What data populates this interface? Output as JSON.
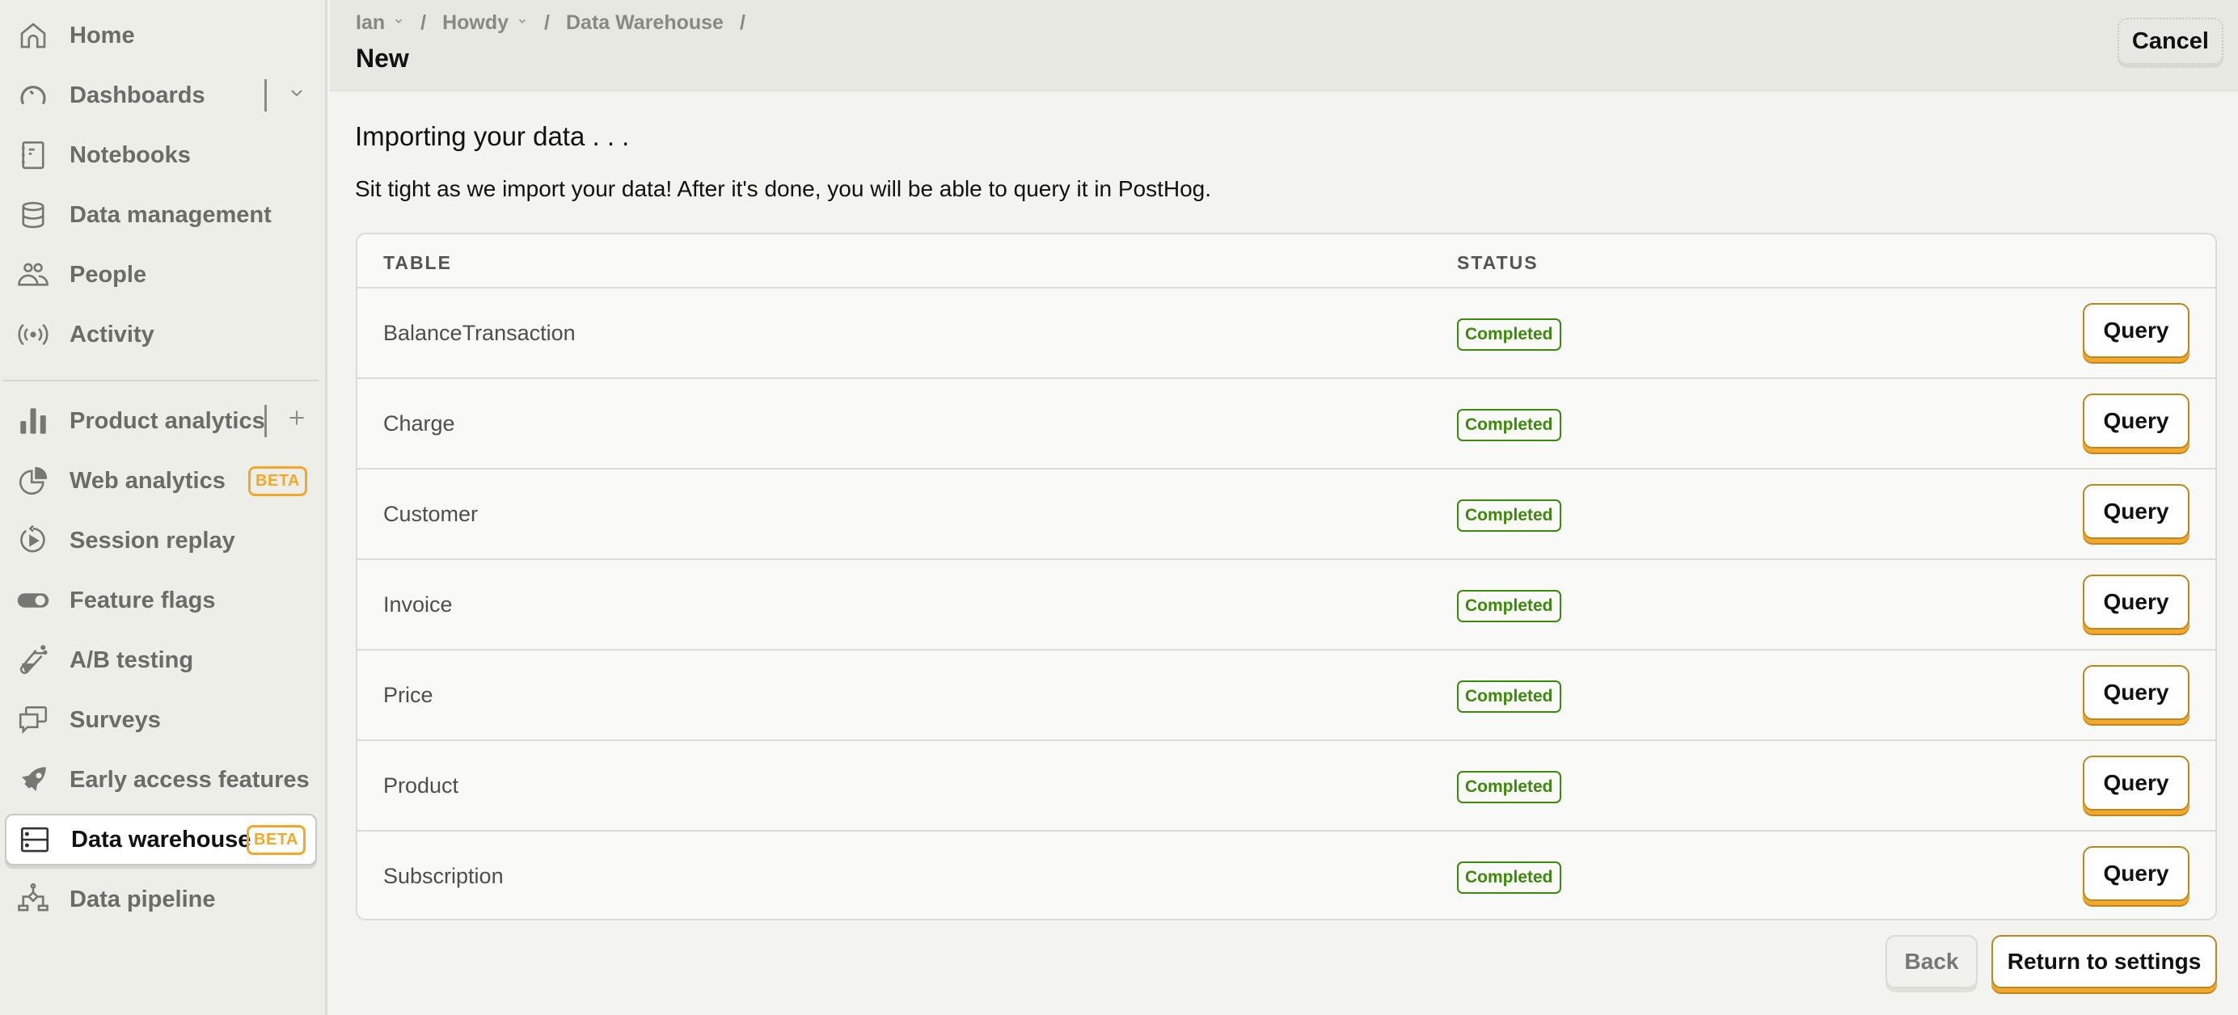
{
  "sidebar": {
    "items": [
      {
        "label": "Home",
        "icon": "home-icon"
      },
      {
        "label": "Dashboards",
        "icon": "dashboard-gauge-icon",
        "extra": "chevron-down"
      },
      {
        "label": "Notebooks",
        "icon": "notebook-icon"
      },
      {
        "label": "Data management",
        "icon": "database-icon"
      },
      {
        "label": "People",
        "icon": "people-icon"
      },
      {
        "label": "Activity",
        "icon": "activity-broadcast-icon"
      },
      {
        "label": "Product analytics",
        "icon": "bar-chart-icon",
        "extra": "plus"
      },
      {
        "label": "Web analytics",
        "icon": "pie-chart-icon",
        "badge": "BETA"
      },
      {
        "label": "Session replay",
        "icon": "replay-icon"
      },
      {
        "label": "Feature flags",
        "icon": "toggle-icon"
      },
      {
        "label": "A/B testing",
        "icon": "test-tube-icon"
      },
      {
        "label": "Surveys",
        "icon": "chat-bubbles-icon"
      },
      {
        "label": "Early access features",
        "icon": "rocket-icon"
      },
      {
        "label": "Data warehouse",
        "icon": "server-icon",
        "badge": "BETA",
        "active": true
      },
      {
        "label": "Data pipeline",
        "icon": "pipeline-icon"
      }
    ]
  },
  "header": {
    "breadcrumb": [
      {
        "label": "Ian",
        "dropdown": true
      },
      {
        "label": "Howdy",
        "dropdown": true
      },
      {
        "label": "Data Warehouse",
        "dropdown": false
      }
    ],
    "title": "New",
    "cancel_label": "Cancel"
  },
  "main": {
    "heading": "Importing your data . . .",
    "description": "Sit tight as we import your data! After it's done, you will be able to query it in PostHog.",
    "table": {
      "columns": [
        "TABLE",
        "STATUS"
      ],
      "rows": [
        {
          "name": "BalanceTransaction",
          "status": "Completed",
          "action": "Query"
        },
        {
          "name": "Charge",
          "status": "Completed",
          "action": "Query"
        },
        {
          "name": "Customer",
          "status": "Completed",
          "action": "Query"
        },
        {
          "name": "Invoice",
          "status": "Completed",
          "action": "Query"
        },
        {
          "name": "Price",
          "status": "Completed",
          "action": "Query"
        },
        {
          "name": "Product",
          "status": "Completed",
          "action": "Query"
        },
        {
          "name": "Subscription",
          "status": "Completed",
          "action": "Query"
        }
      ]
    },
    "back_label": "Back",
    "return_label": "Return to settings"
  },
  "colors": {
    "accent": "#f1a82c",
    "success": "#3b8a0c",
    "sidebar_bg": "#eeeee9",
    "header_bg": "#e8e8e3"
  }
}
